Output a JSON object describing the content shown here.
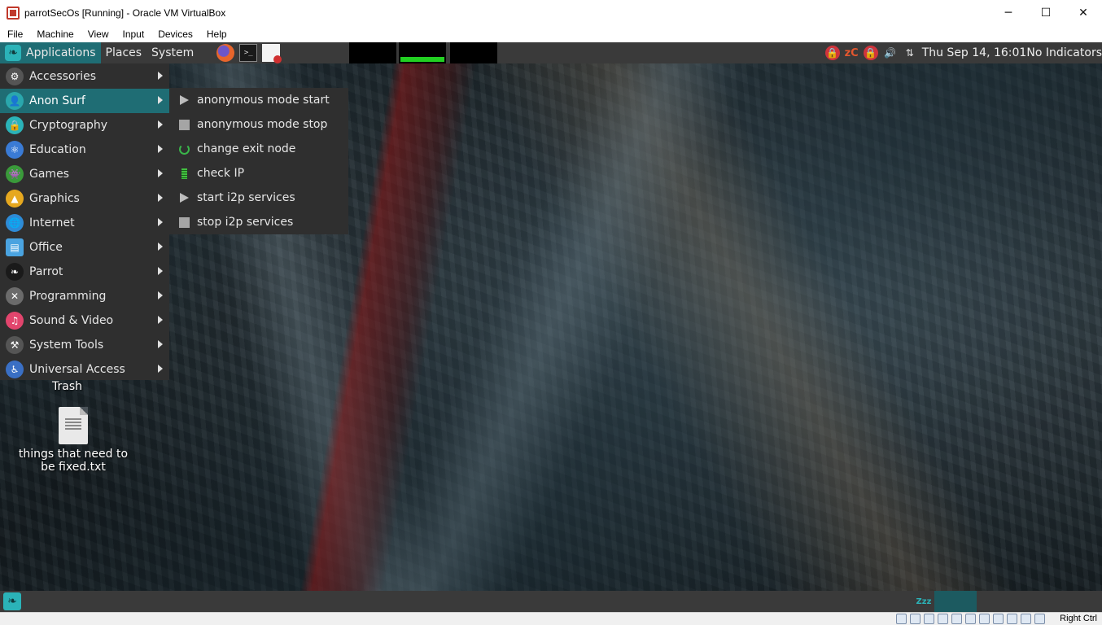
{
  "window": {
    "title": "parrotSecOs [Running] - Oracle VM VirtualBox",
    "minimize_glyph": "─",
    "maximize_glyph": "☐",
    "close_glyph": "✕"
  },
  "vbox_menu": [
    "File",
    "Machine",
    "View",
    "Input",
    "Devices",
    "Help"
  ],
  "top_panel": {
    "applications_label": "Applications",
    "places_label": "Places",
    "system_label": "System",
    "launchers": [
      "firefox-icon",
      "terminal-icon",
      "text-editor-icon"
    ],
    "terminal_glyph": ">_",
    "tray": {
      "zc_label": "zC",
      "clock": "Thu Sep 14, 16:01",
      "indicators": "No Indicators",
      "volume_glyph": "🔊",
      "network_glyph": "⇅",
      "lock_glyph": "🔒"
    }
  },
  "apps_menu": {
    "items": [
      {
        "label": "Accessories",
        "icon": "accessories-icon",
        "color": "#555555",
        "glyph": "⚙"
      },
      {
        "label": "Anon Surf",
        "icon": "anonsurf-icon",
        "color": "#2aa7ad",
        "glyph": "👤",
        "active": true
      },
      {
        "label": "Cryptography",
        "icon": "cryptography-icon",
        "color": "#2bb3b8",
        "glyph": "🔒"
      },
      {
        "label": "Education",
        "icon": "education-icon",
        "color": "#3a7bd5",
        "glyph": "⚛"
      },
      {
        "label": "Games",
        "icon": "games-icon",
        "color": "#3a9a3a",
        "glyph": "👾"
      },
      {
        "label": "Graphics",
        "icon": "graphics-icon",
        "color": "#e6a81f",
        "glyph": "▲"
      },
      {
        "label": "Internet",
        "icon": "internet-icon",
        "color": "#2e8bd6",
        "glyph": "🌐"
      },
      {
        "label": "Office",
        "icon": "office-icon",
        "color": "#4aa3e0",
        "glyph": "▤"
      },
      {
        "label": "Parrot",
        "icon": "parrot-icon",
        "color": "#1a1a1a",
        "glyph": "❧"
      },
      {
        "label": "Programming",
        "icon": "programming-icon",
        "color": "#6b6b6b",
        "glyph": "✕"
      },
      {
        "label": "Sound & Video",
        "icon": "sound-video-icon",
        "color": "#e2456d",
        "glyph": "♫"
      },
      {
        "label": "System Tools",
        "icon": "system-tools-icon",
        "color": "#555555",
        "glyph": "⚒"
      },
      {
        "label": "Universal Access",
        "icon": "universal-access-icon",
        "color": "#3a6fc4",
        "glyph": "♿"
      }
    ]
  },
  "anonsurf_menu": {
    "items": [
      {
        "label": "anonymous mode start",
        "icon": "play-icon"
      },
      {
        "label": "anonymous mode stop",
        "icon": "stop-icon"
      },
      {
        "label": "change exit node",
        "icon": "refresh-icon"
      },
      {
        "label": "check IP",
        "icon": "check-ip-icon"
      },
      {
        "label": "start i2p services",
        "icon": "play-icon"
      },
      {
        "label": "stop i2p services",
        "icon": "stop-icon"
      }
    ]
  },
  "desktop": {
    "trash_label": "Trash",
    "file_label_line1": "things that need to",
    "file_label_line2": "be fixed.txt"
  },
  "bottom_panel": {
    "workspace_label": "Zzz"
  },
  "vbox_status": {
    "host_key": "Right Ctrl"
  },
  "colors": {
    "panel_bg": "#3a3a3a",
    "menu_bg": "#2f2f2f",
    "highlight": "#1f6d74",
    "parrot_accent": "#2bb3b8"
  }
}
